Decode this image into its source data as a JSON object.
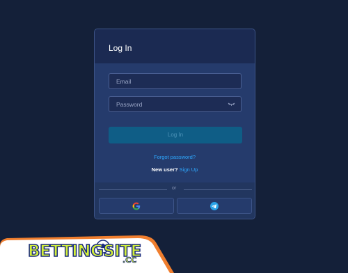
{
  "modal": {
    "title": "Log In",
    "email_placeholder": "Email",
    "password_placeholder": "Password",
    "login_label": "Log In",
    "forgot_label": "Forgot password?",
    "new_user_label": "New user?",
    "signup_label": "Sign Up",
    "divider_label": "or"
  },
  "social": {
    "google_icon": "google-icon",
    "telegram_icon": "telegram-icon"
  },
  "brand": {
    "logo_text": "BETTINGSITE",
    "logo_tld": ".CC"
  },
  "colors": {
    "background": "#142039",
    "modal_header": "#1b2a52",
    "modal_body": "#253b6c",
    "login_button": "#0f5d86",
    "link": "#2ea8ff",
    "banner_orange": "#f07e2e",
    "logo_yellow": "#d4f03a"
  }
}
